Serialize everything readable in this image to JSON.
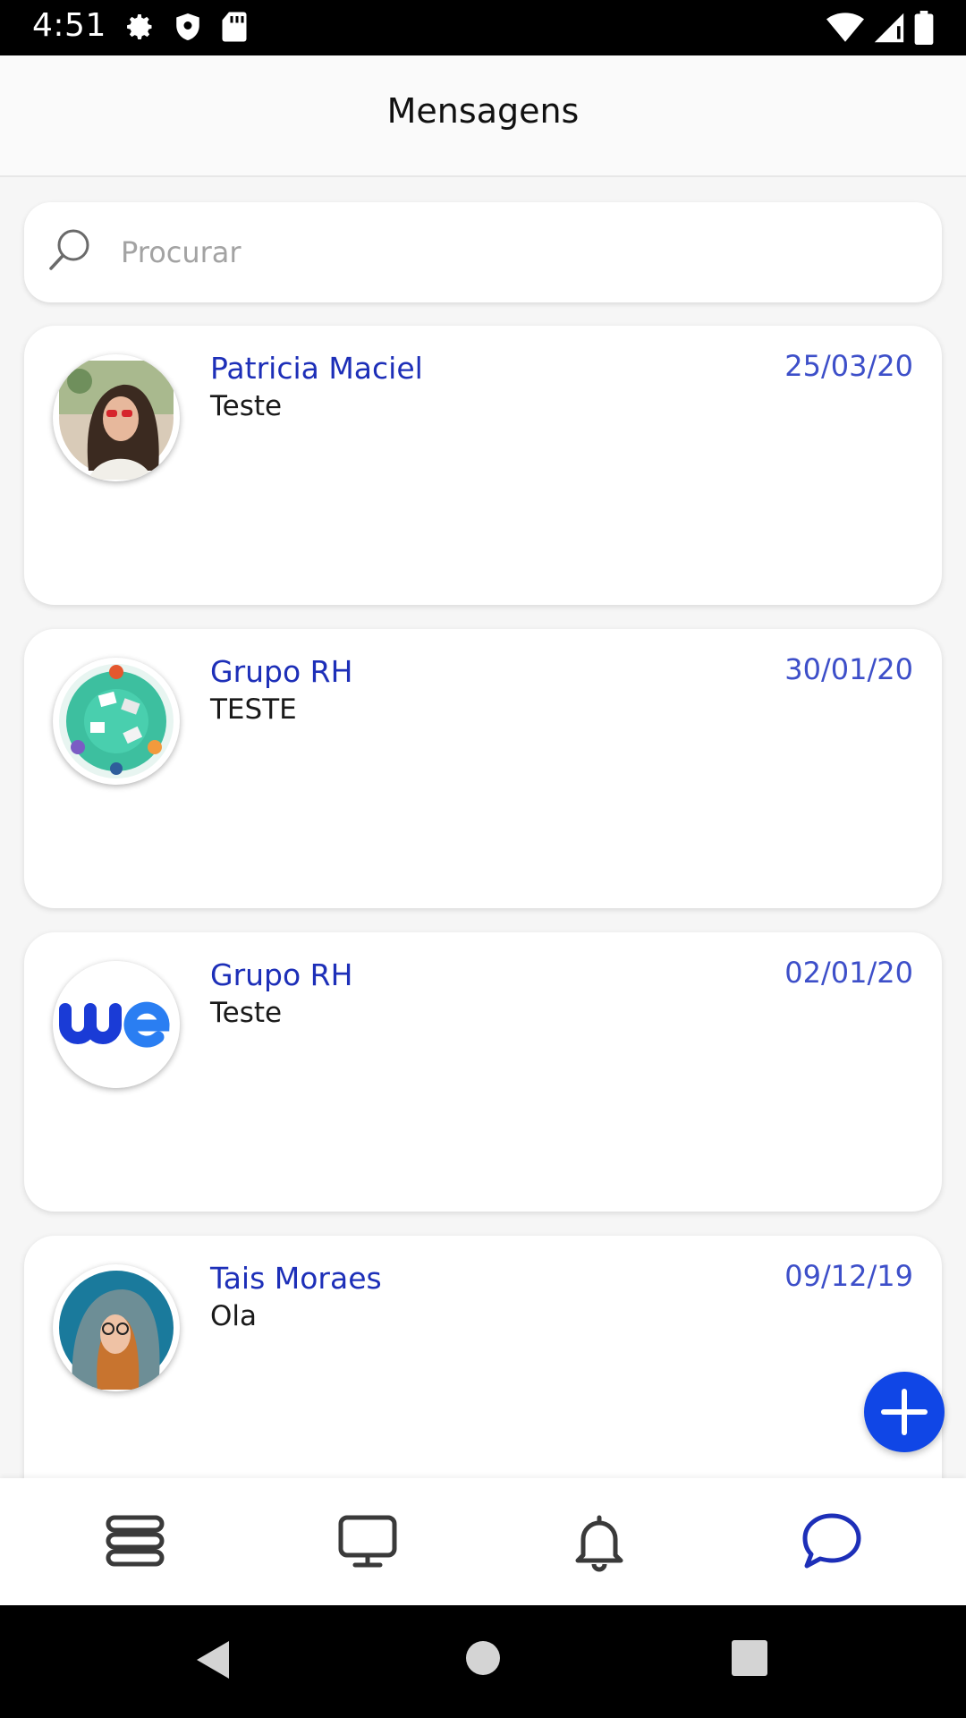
{
  "status_bar": {
    "time": "4:51"
  },
  "header": {
    "title": "Mensagens"
  },
  "search": {
    "placeholder": "Procurar"
  },
  "conversations": [
    {
      "name": "Patricia Maciel",
      "date": "25/03/20",
      "message": "Teste",
      "avatar": "woman-photo"
    },
    {
      "name": "Grupo RH",
      "date": "30/01/20",
      "message": "TESTE",
      "avatar": "team-table-illustration"
    },
    {
      "name": "Grupo RH",
      "date": "02/01/20",
      "message": "Teste",
      "avatar": "we-logo"
    },
    {
      "name": "Tais Moraes",
      "date": "09/12/19",
      "message": "Ola",
      "avatar": "woman-hoodie-photo"
    }
  ],
  "bottom_nav": [
    {
      "icon": "stack-icon",
      "active": false
    },
    {
      "icon": "monitor-icon",
      "active": false
    },
    {
      "icon": "bell-icon",
      "active": false
    },
    {
      "icon": "chat-icon",
      "active": true
    }
  ],
  "colors": {
    "accent": "#1d2fb8",
    "fab": "#1046e6",
    "date": "#3d4fc9"
  }
}
